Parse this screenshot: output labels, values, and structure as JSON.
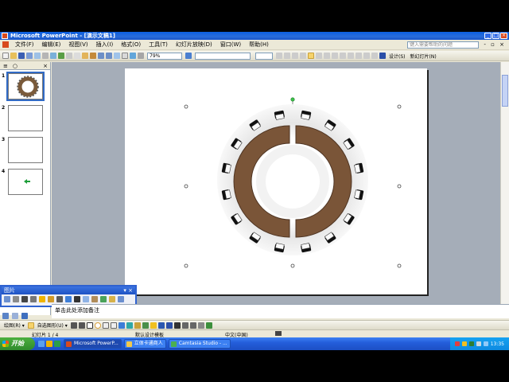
{
  "window": {
    "title": "Microsoft PowerPoint - [演示文稿1]",
    "min": "_",
    "max": "□",
    "close": "×"
  },
  "menu": {
    "items": [
      "文件(F)",
      "编辑(E)",
      "视图(V)",
      "插入(I)",
      "格式(O)",
      "工具(T)",
      "幻灯片放映(D)",
      "窗口(W)",
      "帮助(H)"
    ],
    "help_placeholder": "键入需要帮助的问题",
    "doc_controls": "- ▫ ×"
  },
  "toolbar": {
    "zoom": "79%",
    "design_label": "设计(S)",
    "new_slide_label": "新幻灯片(N)"
  },
  "left_pane": {
    "tab_slides": "≡",
    "tab_outline": "○",
    "close": "×",
    "slides": [
      "1",
      "2",
      "3",
      "4"
    ]
  },
  "picture_toolbar": {
    "title": "图片",
    "close": "▾ ×"
  },
  "notes": {
    "placeholder": "单击此处添加备注"
  },
  "draw_toolbar": {
    "draw_label": "绘图(R) ▾",
    "autoshape_label": "自选图形(U) ▾"
  },
  "status": {
    "slide_info": "幻灯片 1 / 4",
    "template": "默认设计模板",
    "language": "中文(中国)"
  },
  "taskbar": {
    "start": "开始",
    "items": [
      "Microsoft PowerP...",
      "立体卡通商人",
      "Camtasia Studio - ..."
    ],
    "clock": "13:35"
  }
}
